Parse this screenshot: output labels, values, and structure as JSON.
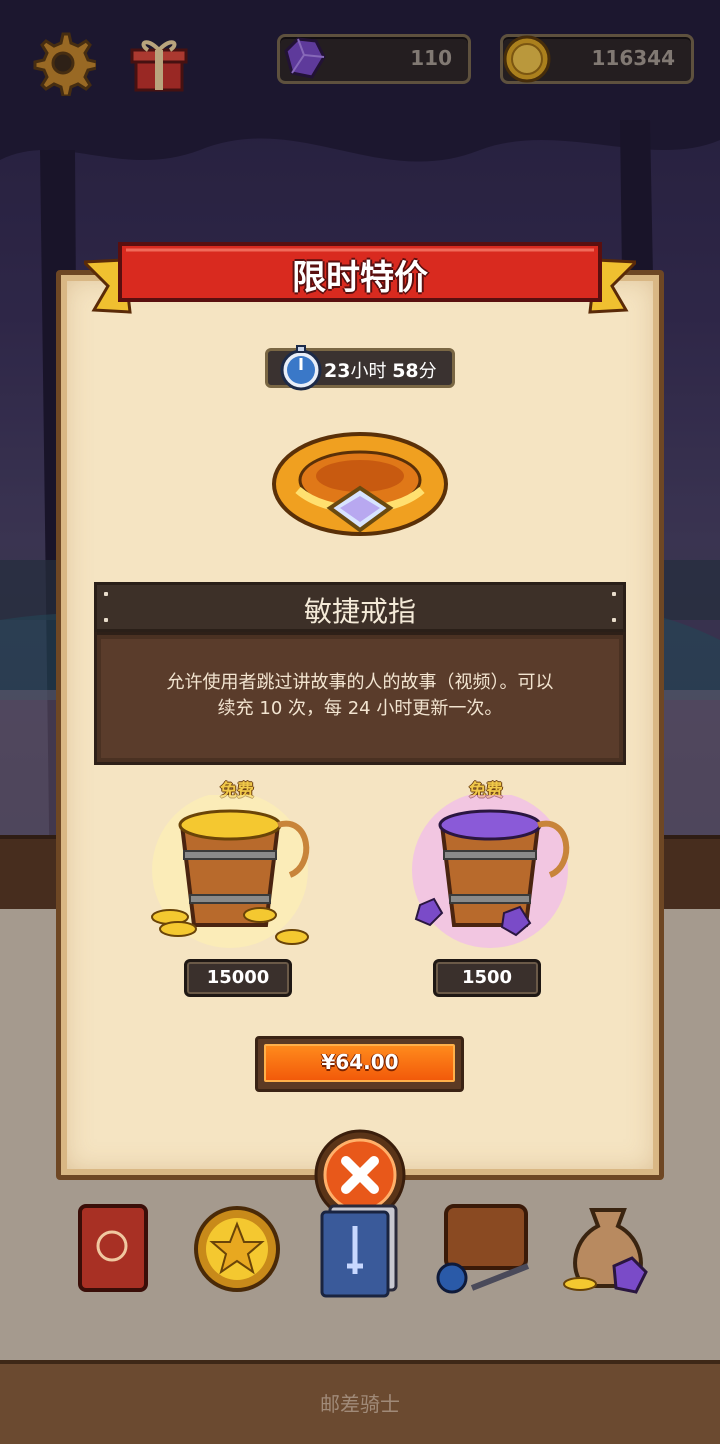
{
  "hud": {
    "gem_count": "110",
    "coin_count": "116344",
    "settings_icon": "gear-icon",
    "gift_icon": "gift-icon"
  },
  "offer": {
    "title": "限时特价",
    "timer_hours": "23",
    "timer_hours_unit": "小时",
    "timer_minutes": "58",
    "timer_minutes_unit": "分",
    "item_name": "敏捷戒指",
    "item_desc_line1": "允许使用者跳过讲故事的人的故事（视频）。可以",
    "item_desc_line2": "续充 10 次，每 24 小时更新一次。",
    "rewards": [
      {
        "free_label": "免费",
        "amount": "15000",
        "kind": "coin-bucket"
      },
      {
        "free_label": "免费",
        "amount": "1500",
        "kind": "gem-bucket"
      }
    ],
    "price": "¥64.00"
  },
  "bottom_nav": [
    {
      "icon": "book-icon"
    },
    {
      "icon": "star-coin-icon"
    },
    {
      "icon": "card-deck-icon"
    },
    {
      "icon": "inventory-bag-icon"
    },
    {
      "icon": "loot-sack-icon"
    }
  ],
  "footer": "邮差骑士",
  "colors": {
    "ribbon_red": "#d92a1f",
    "panel_bg": "#f5e4c2",
    "price_orange": "#f25a0a",
    "gold": "#f0c84a"
  }
}
